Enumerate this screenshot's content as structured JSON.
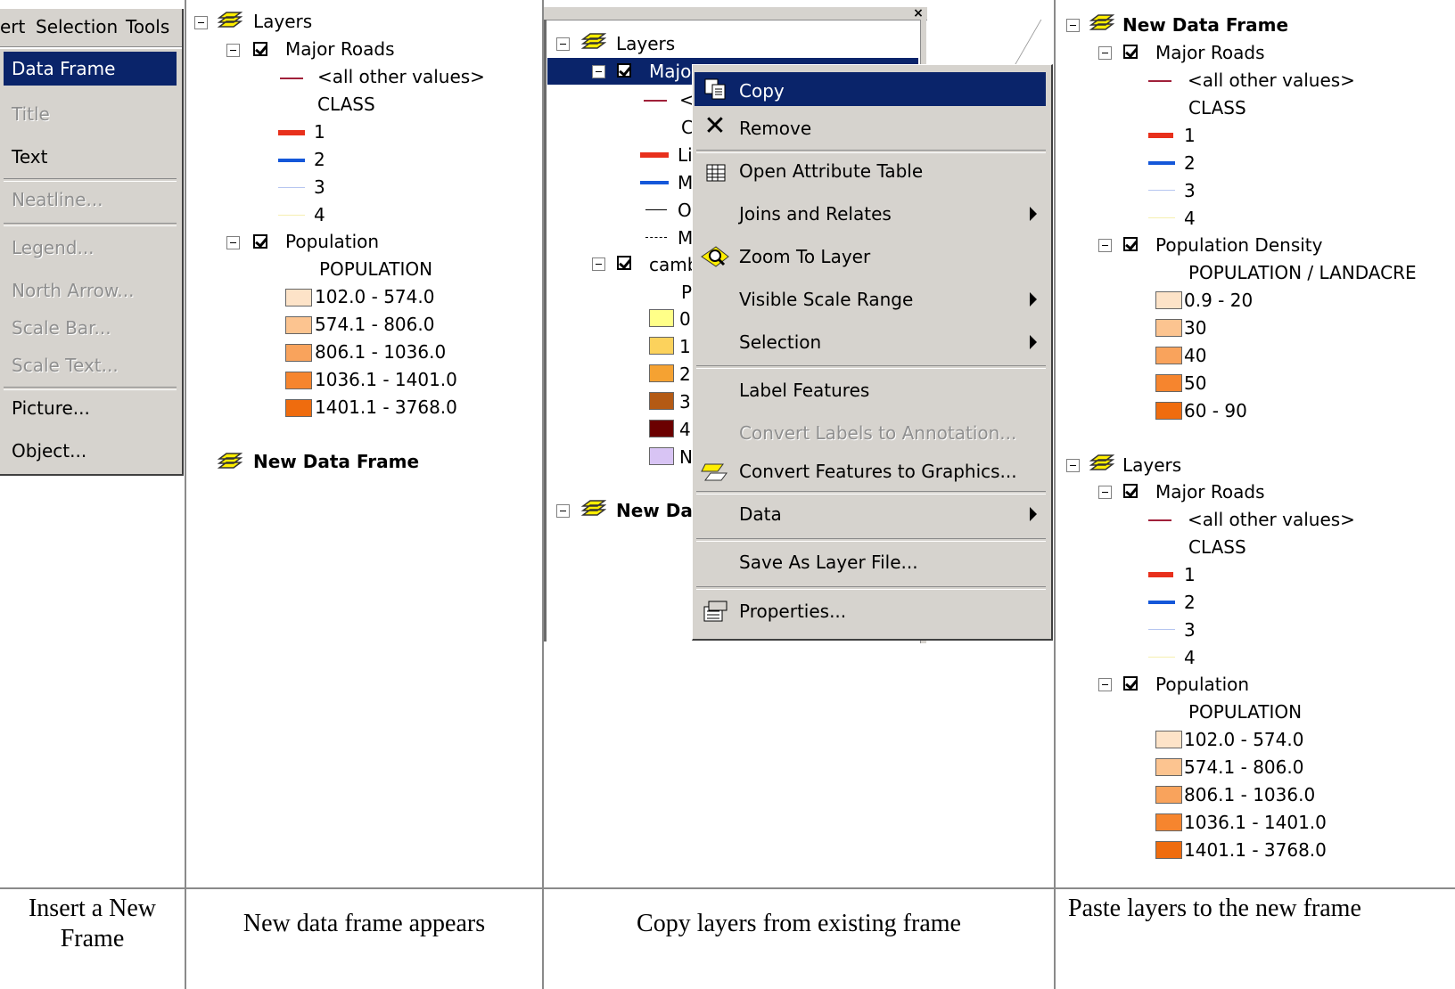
{
  "captions": [
    "Insert a New Frame",
    "New data frame appears",
    "Copy layers from existing frame",
    "Paste layers to the new frame"
  ],
  "panel1": {
    "menubar": [
      "ert",
      "Selection",
      "Tools"
    ],
    "items": [
      {
        "label": "Data Frame",
        "state": "highlighted"
      },
      {
        "label": "Title",
        "state": "disabled"
      },
      {
        "label": "Text",
        "state": "enabled"
      },
      {
        "label": "Neatline...",
        "state": "disabled"
      },
      {
        "label": "Legend...",
        "state": "disabled"
      },
      {
        "label": "North Arrow...",
        "state": "disabled"
      },
      {
        "label": "Scale Bar...",
        "state": "disabled"
      },
      {
        "label": "Scale Text...",
        "state": "disabled"
      },
      {
        "label": "Picture...",
        "state": "enabled"
      },
      {
        "label": "Object...",
        "state": "enabled"
      }
    ]
  },
  "panel2": {
    "frame_name": "Layers",
    "layer1": {
      "name": "Major Roads",
      "other": "<all other values>",
      "field": "CLASS",
      "classes": [
        "1",
        "2",
        "3",
        "4"
      ]
    },
    "layer2": {
      "name": "Population",
      "field": "POPULATION",
      "ranges": [
        "102.0 - 574.0",
        "574.1 - 806.0",
        "806.1 - 1036.0",
        "1036.1 - 1401.0",
        "1401.1 - 3768.0"
      ]
    },
    "new_frame": "New Data Frame"
  },
  "panel3": {
    "frame_name": "Layers",
    "selected_layer": "Majo",
    "frag": {
      "lt": "<",
      "c": "C",
      "li": "Li",
      "m1": "M",
      "o": "O",
      "m2": "M",
      "camb": "camb",
      "p": "P",
      "v0": "0",
      "v1": "1",
      "v2": "2",
      "v3": "3",
      "v4": "4",
      "n": "N"
    },
    "new_frame": "New Dat",
    "context_menu": [
      {
        "label": "Copy",
        "state": "highlighted",
        "icon": "copy-icon"
      },
      {
        "label": "Remove",
        "icon": "remove-x-icon"
      },
      {
        "label": "Open Attribute Table",
        "icon": "table-icon"
      },
      {
        "label": "Joins and Relates",
        "submenu": true
      },
      {
        "label": "Zoom To Layer",
        "icon": "zoom-icon"
      },
      {
        "label": "Visible Scale Range",
        "submenu": true
      },
      {
        "label": "Selection",
        "submenu": true
      },
      {
        "label": "Label Features"
      },
      {
        "label": "Convert Labels to Annotation...",
        "state": "disabled"
      },
      {
        "label": "Convert Features to Graphics...",
        "icon": "convert-graphics-icon"
      },
      {
        "label": "Data",
        "submenu": true
      },
      {
        "label": "Save As Layer File..."
      },
      {
        "label": "Properties...",
        "icon": "properties-icon"
      }
    ]
  },
  "panel4": {
    "frame1": "New Data Frame",
    "f1_layer1": {
      "name": "Major Roads",
      "other": "<all other values>",
      "field": "CLASS",
      "classes": [
        "1",
        "2",
        "3",
        "4"
      ]
    },
    "f1_layer2": {
      "name": "Population Density",
      "field": "POPULATION / LANDACRE",
      "ranges": [
        "0.9 - 20",
        "30",
        "40",
        "50",
        "60 - 90"
      ]
    },
    "frame2": "Layers",
    "f2_layer1": {
      "name": "Major Roads",
      "other": "<all other values>",
      "field": "CLASS",
      "classes": [
        "1",
        "2",
        "3",
        "4"
      ]
    },
    "f2_layer2": {
      "name": "Population",
      "field": "POPULATION",
      "ranges": [
        "102.0 - 574.0",
        "574.1 - 806.0",
        "806.1 - 1036.0",
        "1036.1 - 1401.0",
        "1401.1 - 3768.0"
      ]
    }
  },
  "colors": {
    "menu_bg": "#d6d3ce",
    "highlight": "#0a246a",
    "road1": "#e8301c",
    "road2": "#1457d9",
    "road3": "#b6c6f0",
    "road4": "#f5efb0",
    "other_line": "#a0203a",
    "pop": [
      "#fde3c8",
      "#fcc490",
      "#f9a35c",
      "#f6852e",
      "#ef6c0e"
    ],
    "camb": [
      "#ffff88",
      "#fcd25c",
      "#f5a232",
      "#b45a14",
      "#6b0000",
      "#d8c4f4"
    ]
  }
}
